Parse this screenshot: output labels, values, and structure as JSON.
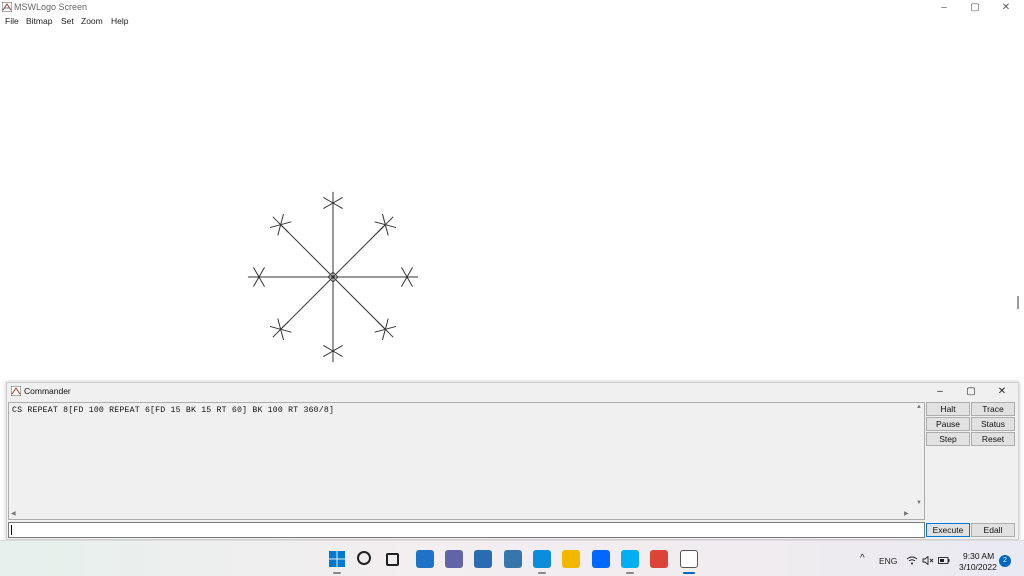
{
  "window": {
    "title": "MSWLogo Screen",
    "controls": {
      "minimize": "–",
      "maximize": "▢",
      "close": "✕"
    }
  },
  "menu": [
    "File",
    "Bitmap",
    "Set",
    "Zoom",
    "Help"
  ],
  "drawing": {
    "description_command": "CS REPEAT 8[FD 100 REPEAT 6[FD 15 BK 15 RT 60] BK 100 RT 360/8]",
    "arms": 8,
    "arm_length": 100,
    "spoke_count": 6,
    "spoke_length": 15,
    "line_color": "#333333"
  },
  "commander": {
    "title": "Commander",
    "history": "CS REPEAT 8[FD 100 REPEAT 6[FD 15 BK 15 RT 60] BK 100 RT 360/8]",
    "input_value": "",
    "buttons": {
      "halt": "Halt",
      "trace": "Trace",
      "pause": "Pause",
      "status": "Status",
      "step": "Step",
      "reset": "Reset",
      "execute": "Execute",
      "edall": "Edall"
    }
  },
  "taskbar": {
    "apps": [
      {
        "name": "start",
        "color": "#0078d4"
      },
      {
        "name": "search",
        "color": "#222222"
      },
      {
        "name": "task-view",
        "color": "#222222"
      },
      {
        "name": "widgets",
        "color": "#1e73c9"
      },
      {
        "name": "teams-chat",
        "color": "#6264a7"
      },
      {
        "name": "store",
        "color": "#2b6cb0"
      },
      {
        "name": "python",
        "color": "#3776ab"
      },
      {
        "name": "edge",
        "color": "#0c8ddb"
      },
      {
        "name": "file-explorer",
        "color": "#f2b800"
      },
      {
        "name": "zalo",
        "color": "#0068ff"
      },
      {
        "name": "skype",
        "color": "#00aff0"
      },
      {
        "name": "chrome",
        "color": "#db4437"
      },
      {
        "name": "mswlogo",
        "color": "#b03a2e"
      }
    ],
    "tray": {
      "chevron": "^",
      "language": "ENG",
      "time": "9:30 AM",
      "date": "3/10/2022",
      "notifications": "2"
    }
  }
}
